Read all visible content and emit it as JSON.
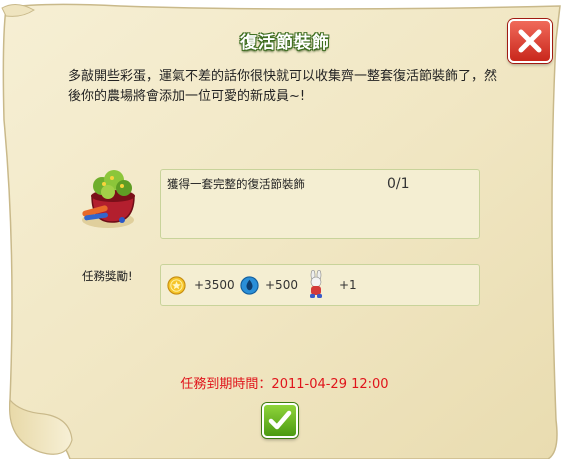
{
  "dialog": {
    "title": "復活節裝飾",
    "description": "多敲開些彩蛋，運氣不差的話你很快就可以收集齊一整套復活節裝飾了，然後你的農場將會添加一位可愛的新成員~!",
    "close_icon": "close-icon"
  },
  "task": {
    "label": "獲得一套完整的復活節裝飾",
    "progress": "0/1",
    "icon": "easter-egg-basket-icon"
  },
  "reward": {
    "label": "任務獎勵!",
    "coins": "+3500",
    "xp": "+500",
    "item": "+1",
    "coin_icon": "gold-coin-icon",
    "xp_icon": "xp-drop-icon",
    "item_icon": "bunny-icon"
  },
  "deadline": "任務到期時間：2011-04-29 12:00",
  "confirm_icon": "checkmark-icon",
  "colors": {
    "parchment": "#f2e9c8",
    "title_green": "#3c6c1e",
    "deadline_red": "#e0141b",
    "close_red": "#d8372a",
    "confirm_green": "#6ab82a"
  }
}
